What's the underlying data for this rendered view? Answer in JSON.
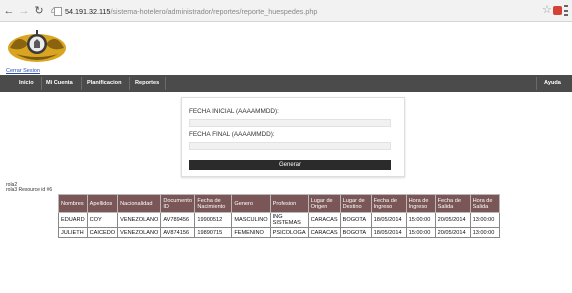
{
  "browser": {
    "url_host": "54.191.32.115",
    "url_path": "/sistema-hotelero/administrador/reportes/reporte_huespedes.php",
    "icons": {
      "back": "arrow-left-icon",
      "forward": "arrow-right-icon",
      "reload": "reload-icon",
      "home": "home-icon",
      "bookmark": "star-icon",
      "extension": "extension-icon",
      "menu": "hamburger-menu-icon"
    }
  },
  "header": {
    "logout_label": "Cerrar Sesion"
  },
  "menu": {
    "items": [
      "Inicio",
      "Mi Cuenta",
      "Planificacion",
      "Reportes"
    ],
    "right_item": "Ayuda"
  },
  "form": {
    "start_label": "FECHA INICIAL (AAAAMMDD):",
    "start_value": "",
    "end_label": "FECHA FINAL (AAAAMMDD):",
    "end_value": "",
    "submit_label": "Generar"
  },
  "debug": {
    "line1": "rola2",
    "line2": "rola3 Resource id #6"
  },
  "table": {
    "headers": [
      "Nombres",
      "Apellidos",
      "Nacionalidad",
      "Documento ID",
      "Fecha de Nacimiento",
      "Genero",
      "Profesion",
      "Lugar de Origen",
      "Lugar de Destino",
      "Fecha de Ingreso",
      "Hora de Ingreso",
      "Fecha de Salida",
      "Hora de Salida"
    ],
    "rows": [
      [
        "EDUARD",
        "COY",
        "VENEZOLANO",
        "AV789456",
        "19900512",
        "MASCULINO",
        "ING SISTEMAS",
        "CARACAS",
        "BOGOTA",
        "18/05/2014",
        "15:00:00",
        "20/05/2014",
        "13:00:00"
      ],
      [
        "JULIETH",
        "CAICEDO",
        "VENEZOLANO",
        "AV874156",
        "19890715",
        "FEMENINO",
        "PSICOLOGA",
        "CARACAS",
        "BOGOTA",
        "18/05/2014",
        "15:00:00",
        "20/05/2014",
        "13:00:00"
      ]
    ]
  },
  "colors": {
    "menubar": "#4b4b4b",
    "table_header": "#7a5656",
    "button": "#2b2b2b",
    "link": "#2a4fb0"
  }
}
